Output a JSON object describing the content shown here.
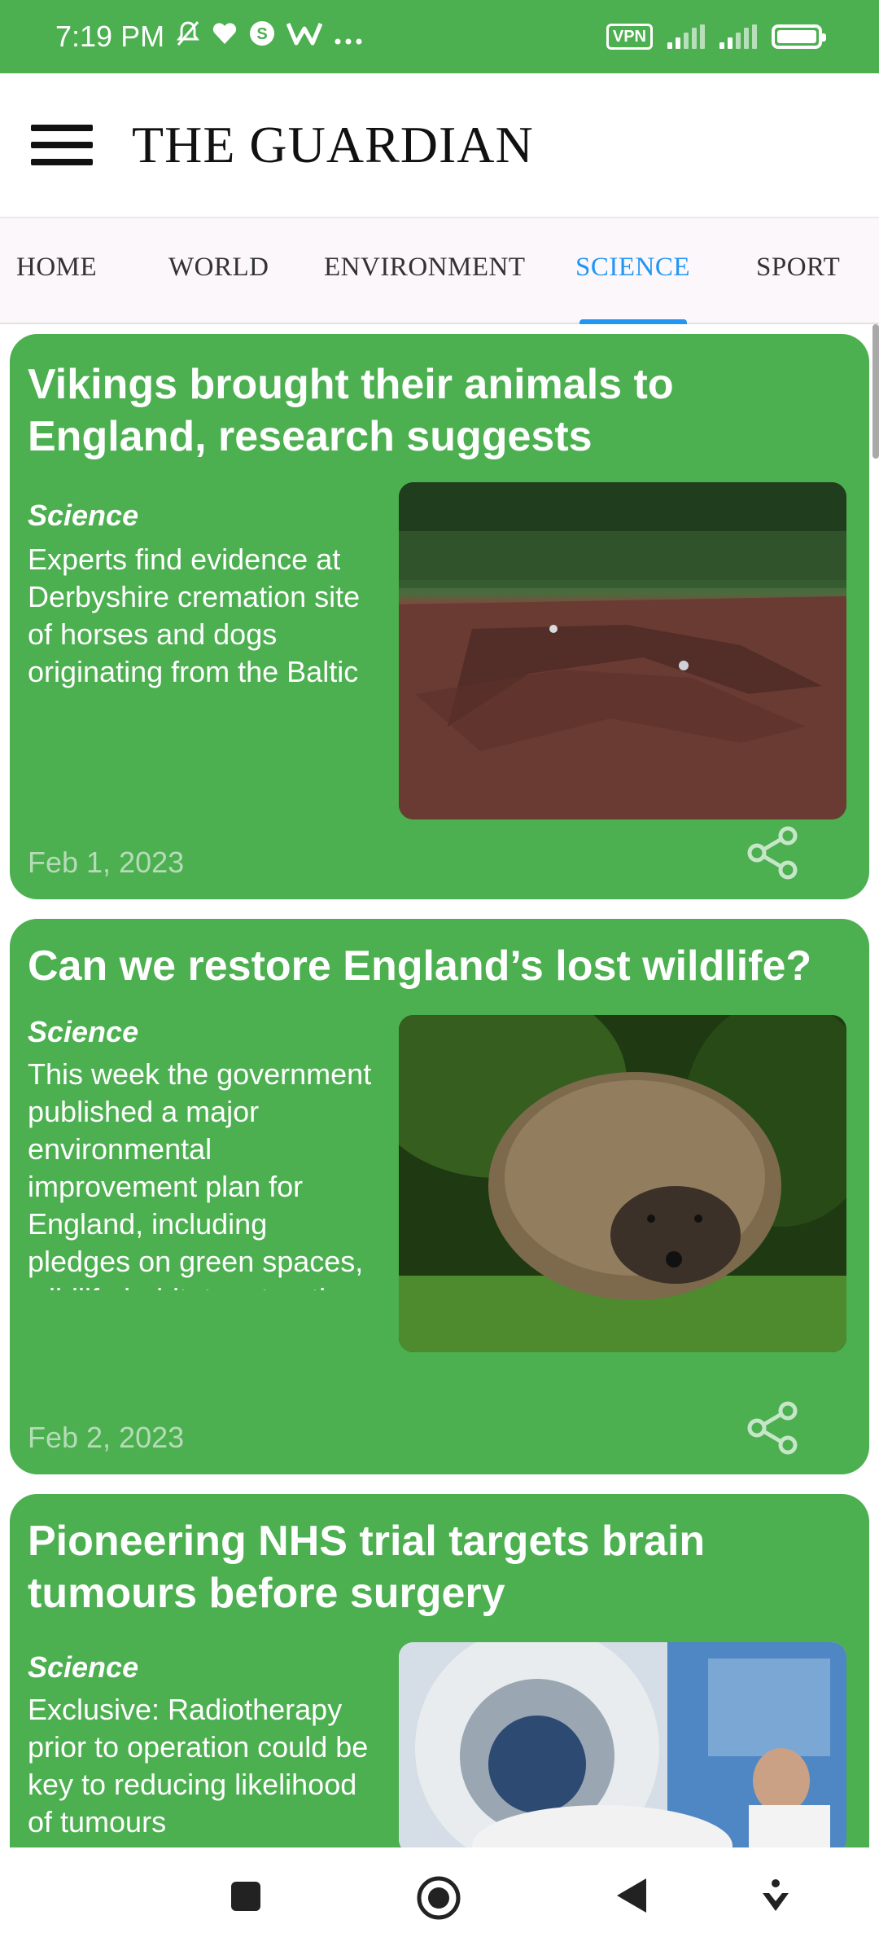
{
  "status_bar": {
    "time": "7:19 PM",
    "icons": [
      "bell-off-icon",
      "heart-icon",
      "s-circle-icon",
      "w-app-icon",
      "more-dots-icon"
    ],
    "vpn_label": "VPN",
    "battery_level": 1.0
  },
  "app_bar": {
    "title": "THE GUARDIAN",
    "menu_icon": "hamburger-menu-icon"
  },
  "tabs": [
    {
      "label": "HOME",
      "active": false
    },
    {
      "label": "WORLD",
      "active": false
    },
    {
      "label": "ENVIRONMENT",
      "active": false
    },
    {
      "label": "SCIENCE",
      "active": true
    },
    {
      "label": "SPORT",
      "active": false
    }
  ],
  "accent_color": "#2196f3",
  "card_color": "#4caf50",
  "articles": [
    {
      "title": "Vikings brought their animals to England, research suggests",
      "section": "Science",
      "description": "Experts find evidence at Derbyshire cremation site of horses and dogs originating from the Baltic Shield",
      "date": "Feb 1, 2023",
      "image": "excavation-site-photo"
    },
    {
      "title": "Can we restore England’s lost wildlife?",
      "section": "Science",
      "description": "This week the government published a major environmental improvement plan for England, including pledges on green spaces, wildlife habitat restoration and tackling sewage",
      "date": "Feb 2, 2023",
      "image": "hedgehog-photo"
    },
    {
      "title": "Pioneering NHS trial targets brain tumours before surgery",
      "section": "Science",
      "description": "Exclusive: Radiotherapy prior to operation could be key to reducing likelihood of tumours",
      "date": "",
      "image": "radiotherapy-machine-photo"
    }
  ],
  "nav_bar": {
    "buttons": [
      "recents-square-icon",
      "home-circle-icon",
      "back-triangle-icon",
      "assistant-icon"
    ]
  }
}
